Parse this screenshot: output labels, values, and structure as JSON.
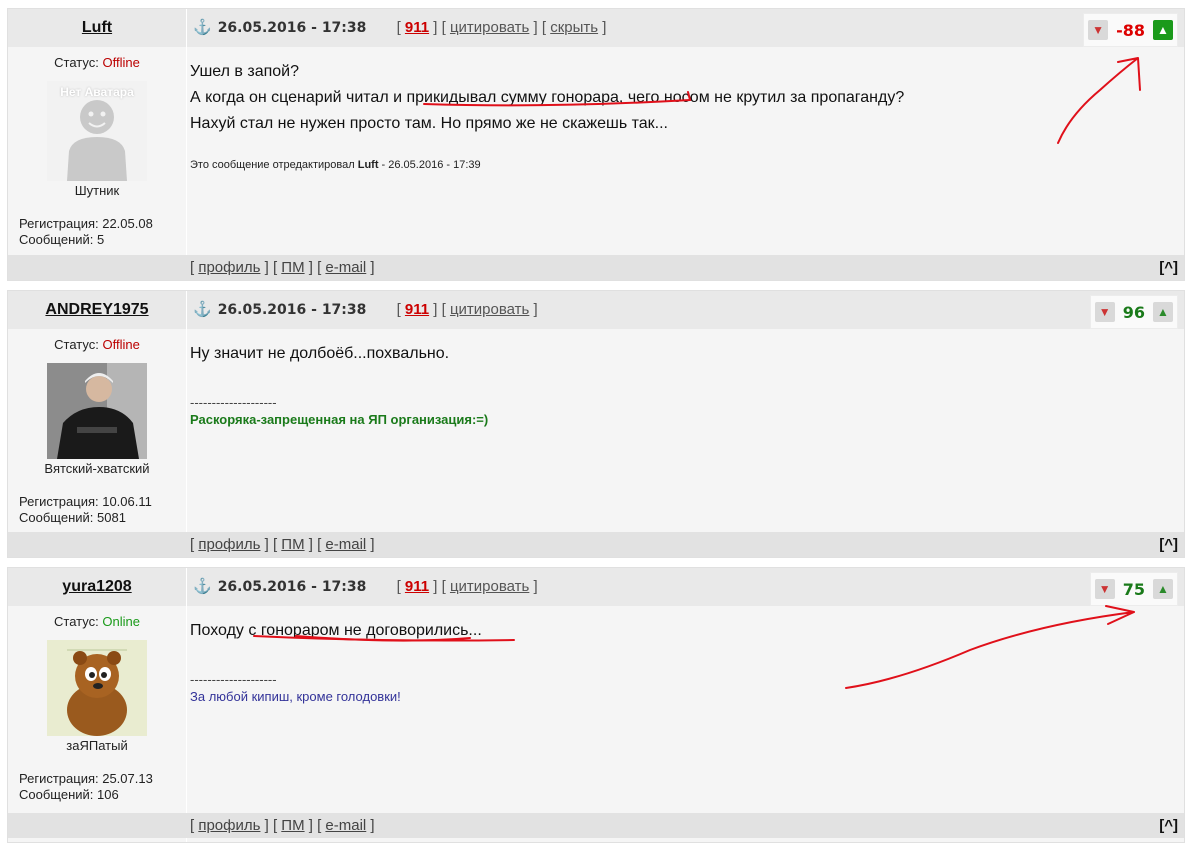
{
  "posts": [
    {
      "author": "Luft",
      "anchor_icon": "anchor-icon",
      "date": "26.05.2016 - 17:38",
      "num": "911",
      "quote": "цитировать",
      "hide": "скрыть",
      "score": "-88",
      "status_label": "Статус:",
      "status": "Offline",
      "avatar_text": "Нет Аватара",
      "rank": "Шутник",
      "reg": "Регистрация: 22.05.08",
      "msgs": "Сообщений: 5",
      "lines": [
        "Ушел в запой?",
        "А когда он сценарий читал и прикидывал сумму гонорара, чего носом не крутил за пропаганду?",
        "Нахуй стал не нужен просто там. Но прямо же не скажешь так..."
      ],
      "edited_prefix": "Это сообщение отредактировал",
      "edited_author": "Luft",
      "edited_suffix": "- 26.05.2016 - 17:39"
    },
    {
      "author": "ANDREY1975",
      "date": "26.05.2016 - 17:38",
      "num": "911",
      "quote": "цитировать",
      "score": "96",
      "status_label": "Статус:",
      "status": "Offline",
      "rank": "Вятский-хватский",
      "reg": "Регистрация: 10.06.11",
      "msgs": "Сообщений: 5081",
      "lines": [
        "Ну значит не долбоёб...похвально."
      ],
      "sig_sep": "--------------------",
      "signature": "Раскоряка-запрещенная на ЯП организация:=)"
    },
    {
      "author": "yura1208",
      "date": "26.05.2016 - 17:38",
      "num": "911",
      "quote": "цитировать",
      "score": "75",
      "status_label": "Статус:",
      "status": "Online",
      "rank": "заЯПатый",
      "reg": "Регистрация: 25.07.13",
      "msgs": "Сообщений: 106",
      "lines": [
        "Походу с гонораром не договорились..."
      ],
      "sig_sep": "--------------------",
      "signature": "За любой кипиш, кроме голодовки!"
    }
  ],
  "footer": {
    "profile": "профиль",
    "pm": "ПМ",
    "email": "e-mail",
    "totop": "[^]"
  },
  "brackets": {
    "open": "[",
    "close": "]"
  },
  "colors": {
    "annotation": "#e0101a",
    "score_negative": "#dd0000",
    "score_positive": "#1a7a1a",
    "online": "#1a9a1a",
    "offline": "#bb0000"
  }
}
